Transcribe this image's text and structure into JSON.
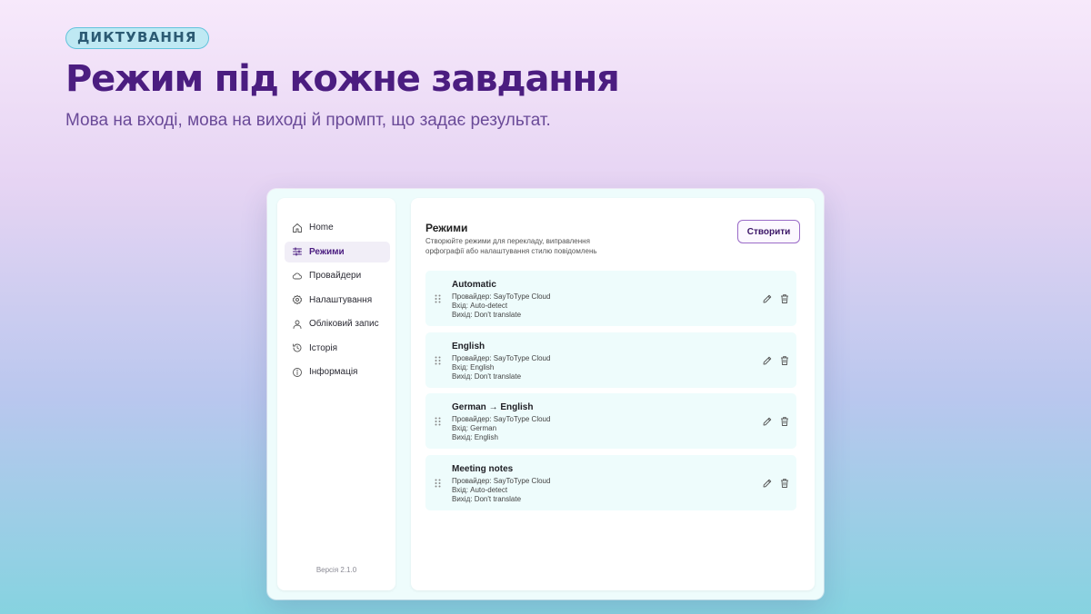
{
  "hero": {
    "badge": "ДИКТУВАННЯ",
    "title": "Режим під кожне завдання",
    "subtitle": "Мова на вході, мова на виході й промпт, що задає результат."
  },
  "sidebar": {
    "items": [
      {
        "label": "Home",
        "icon": "home-icon",
        "active": false
      },
      {
        "label": "Режими",
        "icon": "sliders-icon",
        "active": true
      },
      {
        "label": "Провайдери",
        "icon": "cloud-icon",
        "active": false
      },
      {
        "label": "Налаштування",
        "icon": "gear-icon",
        "active": false
      },
      {
        "label": "Обліковий запис",
        "icon": "user-icon",
        "active": false
      },
      {
        "label": "Історія",
        "icon": "history-icon",
        "active": false
      },
      {
        "label": "Інформація",
        "icon": "info-icon",
        "active": false
      }
    ],
    "version": "Версія 2.1.0"
  },
  "main": {
    "title": "Режими",
    "description": "Створюйте режими для перекладу, виправлення орфографії або налаштування стилю повідомлень",
    "create_label": "Створити",
    "modes": [
      {
        "name": "Automatic",
        "provider": "Провайдер: SayToType Cloud",
        "input": "Вхід: Auto-detect",
        "output": "Вихід: Don't translate"
      },
      {
        "name": "English",
        "provider": "Провайдер: SayToType Cloud",
        "input": "Вхід: English",
        "output": "Вихід: Don't translate"
      },
      {
        "name": "German → English",
        "provider": "Провайдер: SayToType Cloud",
        "input": "Вхід: German",
        "output": "Вихід: English"
      },
      {
        "name": "Meeting notes",
        "provider": "Провайдер: SayToType Cloud",
        "input": "Вхід: Auto-detect",
        "output": "Вихід: Don't translate"
      }
    ]
  },
  "colors": {
    "accent": "#4b1d80",
    "card_bg": "#eefcfc",
    "badge_bg": "#bfe9f3"
  }
}
